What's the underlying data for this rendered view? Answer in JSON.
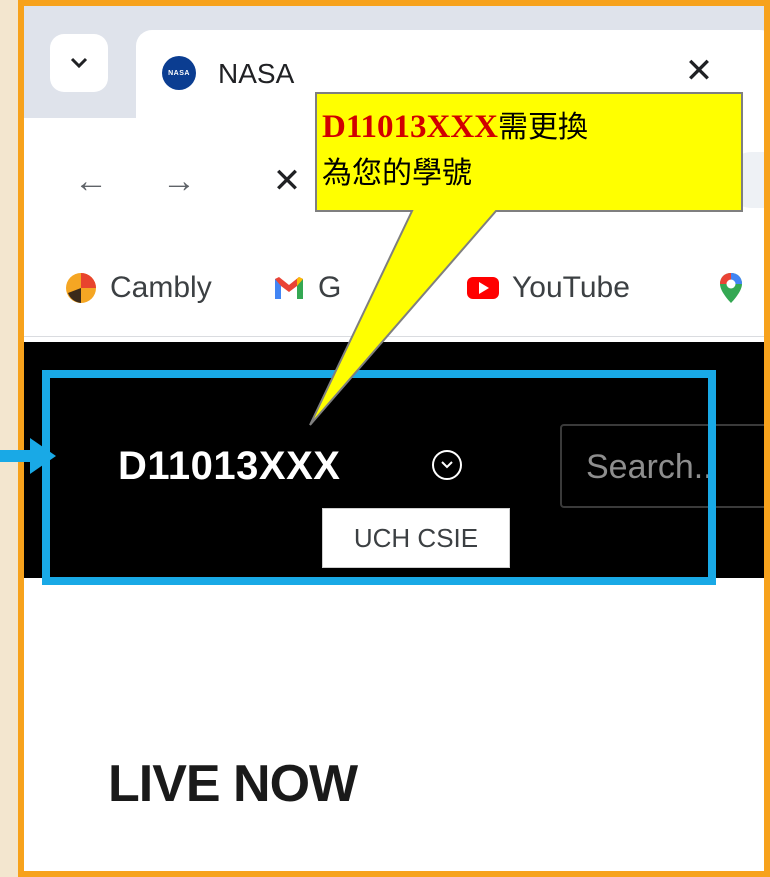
{
  "browser": {
    "tab": {
      "title": "NASA",
      "favicon": "nasa-logo-icon",
      "close_icon": "close-icon"
    },
    "tab_list_icon": "chevron-down-icon",
    "toolbar": {
      "back_icon": "arrow-left-icon",
      "forward_icon": "arrow-right-icon",
      "stop_icon": "close-icon"
    },
    "bookmarks": [
      {
        "label": "Cambly",
        "icon": "cambly-icon"
      },
      {
        "label": "Gmail",
        "visible_text": "G",
        "icon": "gmail-icon"
      },
      {
        "label": "YouTube",
        "icon": "youtube-icon"
      },
      {
        "label": "",
        "icon": "maps-pin-icon"
      }
    ]
  },
  "site": {
    "user_name": "D11013XXX",
    "user_menu_icon": "chevron-down-circle-icon",
    "search_placeholder": "Search..",
    "tooltip": "UCH CSIE",
    "section_heading": "LIVE NOW"
  },
  "annotation": {
    "callout_code": "D11013XXX",
    "callout_line1_rest": "需更換",
    "callout_line2": "為您的學號",
    "callout_color": "#ffff00",
    "highlight_color": "#19a9e6",
    "frame_color": "#f7a21c"
  }
}
